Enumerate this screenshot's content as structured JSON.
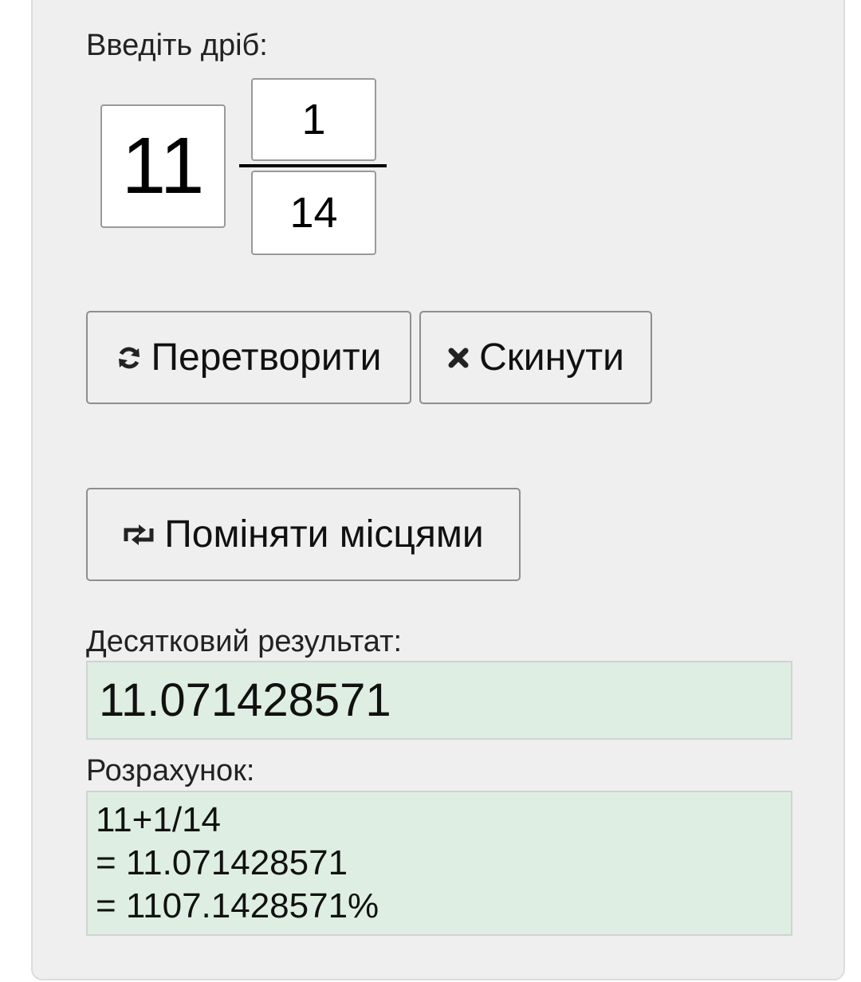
{
  "form": {
    "input_label": "Введіть дріб:",
    "whole": "11",
    "numerator": "1",
    "denominator": "14"
  },
  "buttons": {
    "convert_label": "Перетворити",
    "reset_label": "Скинути",
    "swap_label": "Поміняти місцями"
  },
  "icons": {
    "convert": "refresh-icon",
    "reset": "close-icon",
    "swap": "swap-icon"
  },
  "result": {
    "decimal_label": "Десятковий результат:",
    "decimal_value": "11.071428571",
    "calc_label": "Розрахунок:",
    "calc_lines": [
      "11+1/14",
      "= 11.071428571",
      "= 1107.1428571%"
    ]
  },
  "colors": {
    "panel_bg": "#efefef",
    "result_bg": "#dfeee2"
  }
}
